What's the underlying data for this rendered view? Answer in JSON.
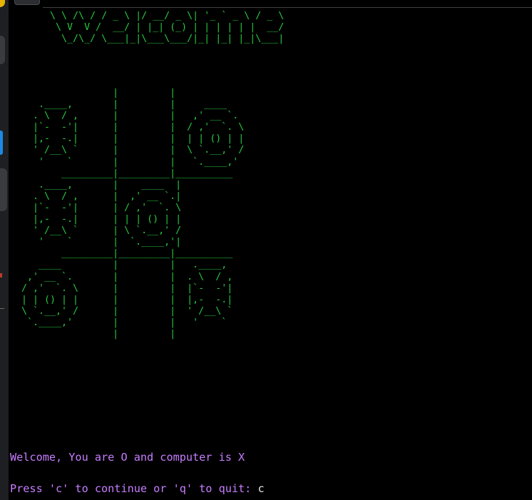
{
  "terminal": {
    "banner_lines": [
      "       \\ \\ /\\ / / _ \\ |/ __/ _ \\| '_ ` _ \\ / _ \\",
      "        \\ V  V /  __/ | |_| (_) | | | | | |  __/",
      "         \\_/\\_/ \\___|_|\\___\\___/|_| |_| |_|\\___|"
    ],
    "board_lines": [
      "                  |         |",
      "     .____,       |         |     ____",
      "    . \\  / ,      |         |   ,' __ `.",
      "    |`-  -'|      |         |  / ,'  `. \\",
      "    |,-  -.|      |         |  | | () | |",
      "    ' /__\\ `      |         |  \\ `.__,' /",
      "     '    `       |         |   `.____,'",
      "         _________|_________|__________",
      "     .____,       |    ____  |",
      "    . \\  / ,      |  ,' __ `.|",
      "    |`-  -'|      | / ,'  `. \\",
      "    |,-  -.|      | | | () | |",
      "    ' /__\\ `      | \\ `.__,' /",
      "     '    `       |  `.____,'|",
      "         _________|_________|__________",
      "     ____         |         |   .____,",
      "   ,' __ `.       |         |  . \\  / ,",
      "  / ,'  `. \\      |         |  |`-  -'|",
      "  | | () | |      |         |  |,-  -.|",
      "  \\ `.__,' /      |         |  ' /__\\ `",
      "   `.____,'       |         |   '    `",
      "                  |         |"
    ],
    "welcome_message": "Welcome, You are O and computer is X",
    "prompt_text": "Press 'c' to continue or 'q' to quit: ",
    "prompt_input": "c"
  },
  "colors": {
    "background": "#000000",
    "ascii_green": "#27c93f",
    "message_purple": "#c77dff"
  }
}
